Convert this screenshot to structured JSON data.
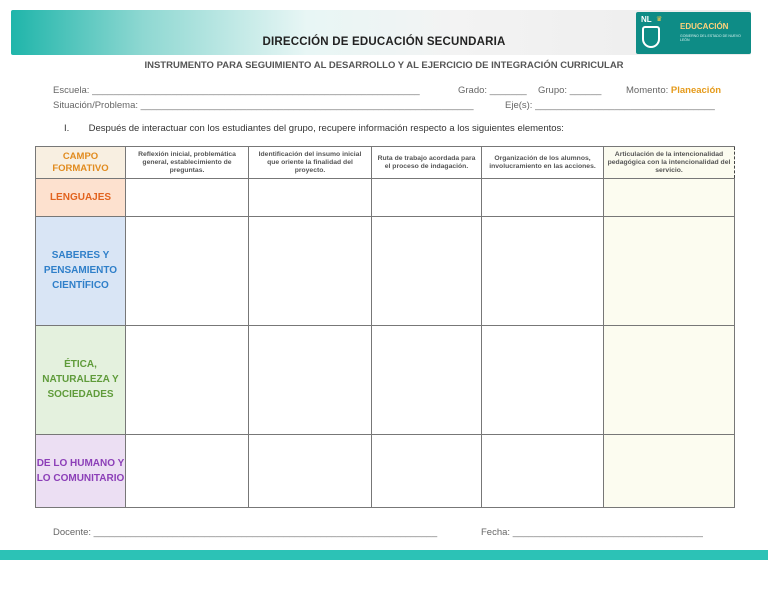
{
  "header": {
    "title": "DIRECCIÓN DE EDUCACIÓN SECUNDARIA",
    "logo": {
      "abbr": "NL",
      "label": "EDUCACIÓN",
      "tagline": "GOBIERNO DEL ESTADO DE NUEVO LEÓN"
    }
  },
  "subtitle": "INSTRUMENTO PARA SEGUIMIENTO AL DESARROLLO Y AL EJERCICIO DE INTEGRACIÓN CURRICULAR",
  "form": {
    "escuela_label": "Escuela:",
    "grado_label": "Grado:",
    "grupo_label": "Grupo:",
    "momento_label": "Momento:",
    "momento_value": "Planeación",
    "situacion_label": "Situación/Problema:",
    "ejes_label": "Eje(s):",
    "docente_label": "Docente:",
    "fecha_label": "Fecha:",
    "line_escuela": "______________________________________________________________",
    "line_grado": "_______",
    "line_grupo": "______",
    "line_situacion": "_______________________________________________________________",
    "line_ejes": "__________________________________",
    "line_docente": "_________________________________________________________________",
    "line_fecha": "____________________________________"
  },
  "instruction": {
    "number": "I.",
    "text": "Después de interactuar con los estudiantes del grupo, recupere información respecto a los siguientes elementos:"
  },
  "table": {
    "headers": [
      "CAMPO FORMATIVO",
      "Reflexión inicial, problemática general, establecimiento de preguntas.",
      "Identificación del insumo inicial que oriente la finalidad del proyecto.",
      "Ruta de trabajo acordada para el proceso de indagación.",
      "Organización de los alumnos, involucramiento en las acciones.",
      "Articulación de la intencionalidad pedagógica con la intencionalidad del servicio."
    ],
    "rows": [
      {
        "campo": "LENGUAJES"
      },
      {
        "campo": "SABERES Y PENSAMIENTO CIENTÍFICO"
      },
      {
        "campo": "ÉTICA, NATURALEZA Y SOCIEDADES"
      },
      {
        "campo": "DE LO HUMANO Y LO COMUNITARIO"
      }
    ]
  }
}
